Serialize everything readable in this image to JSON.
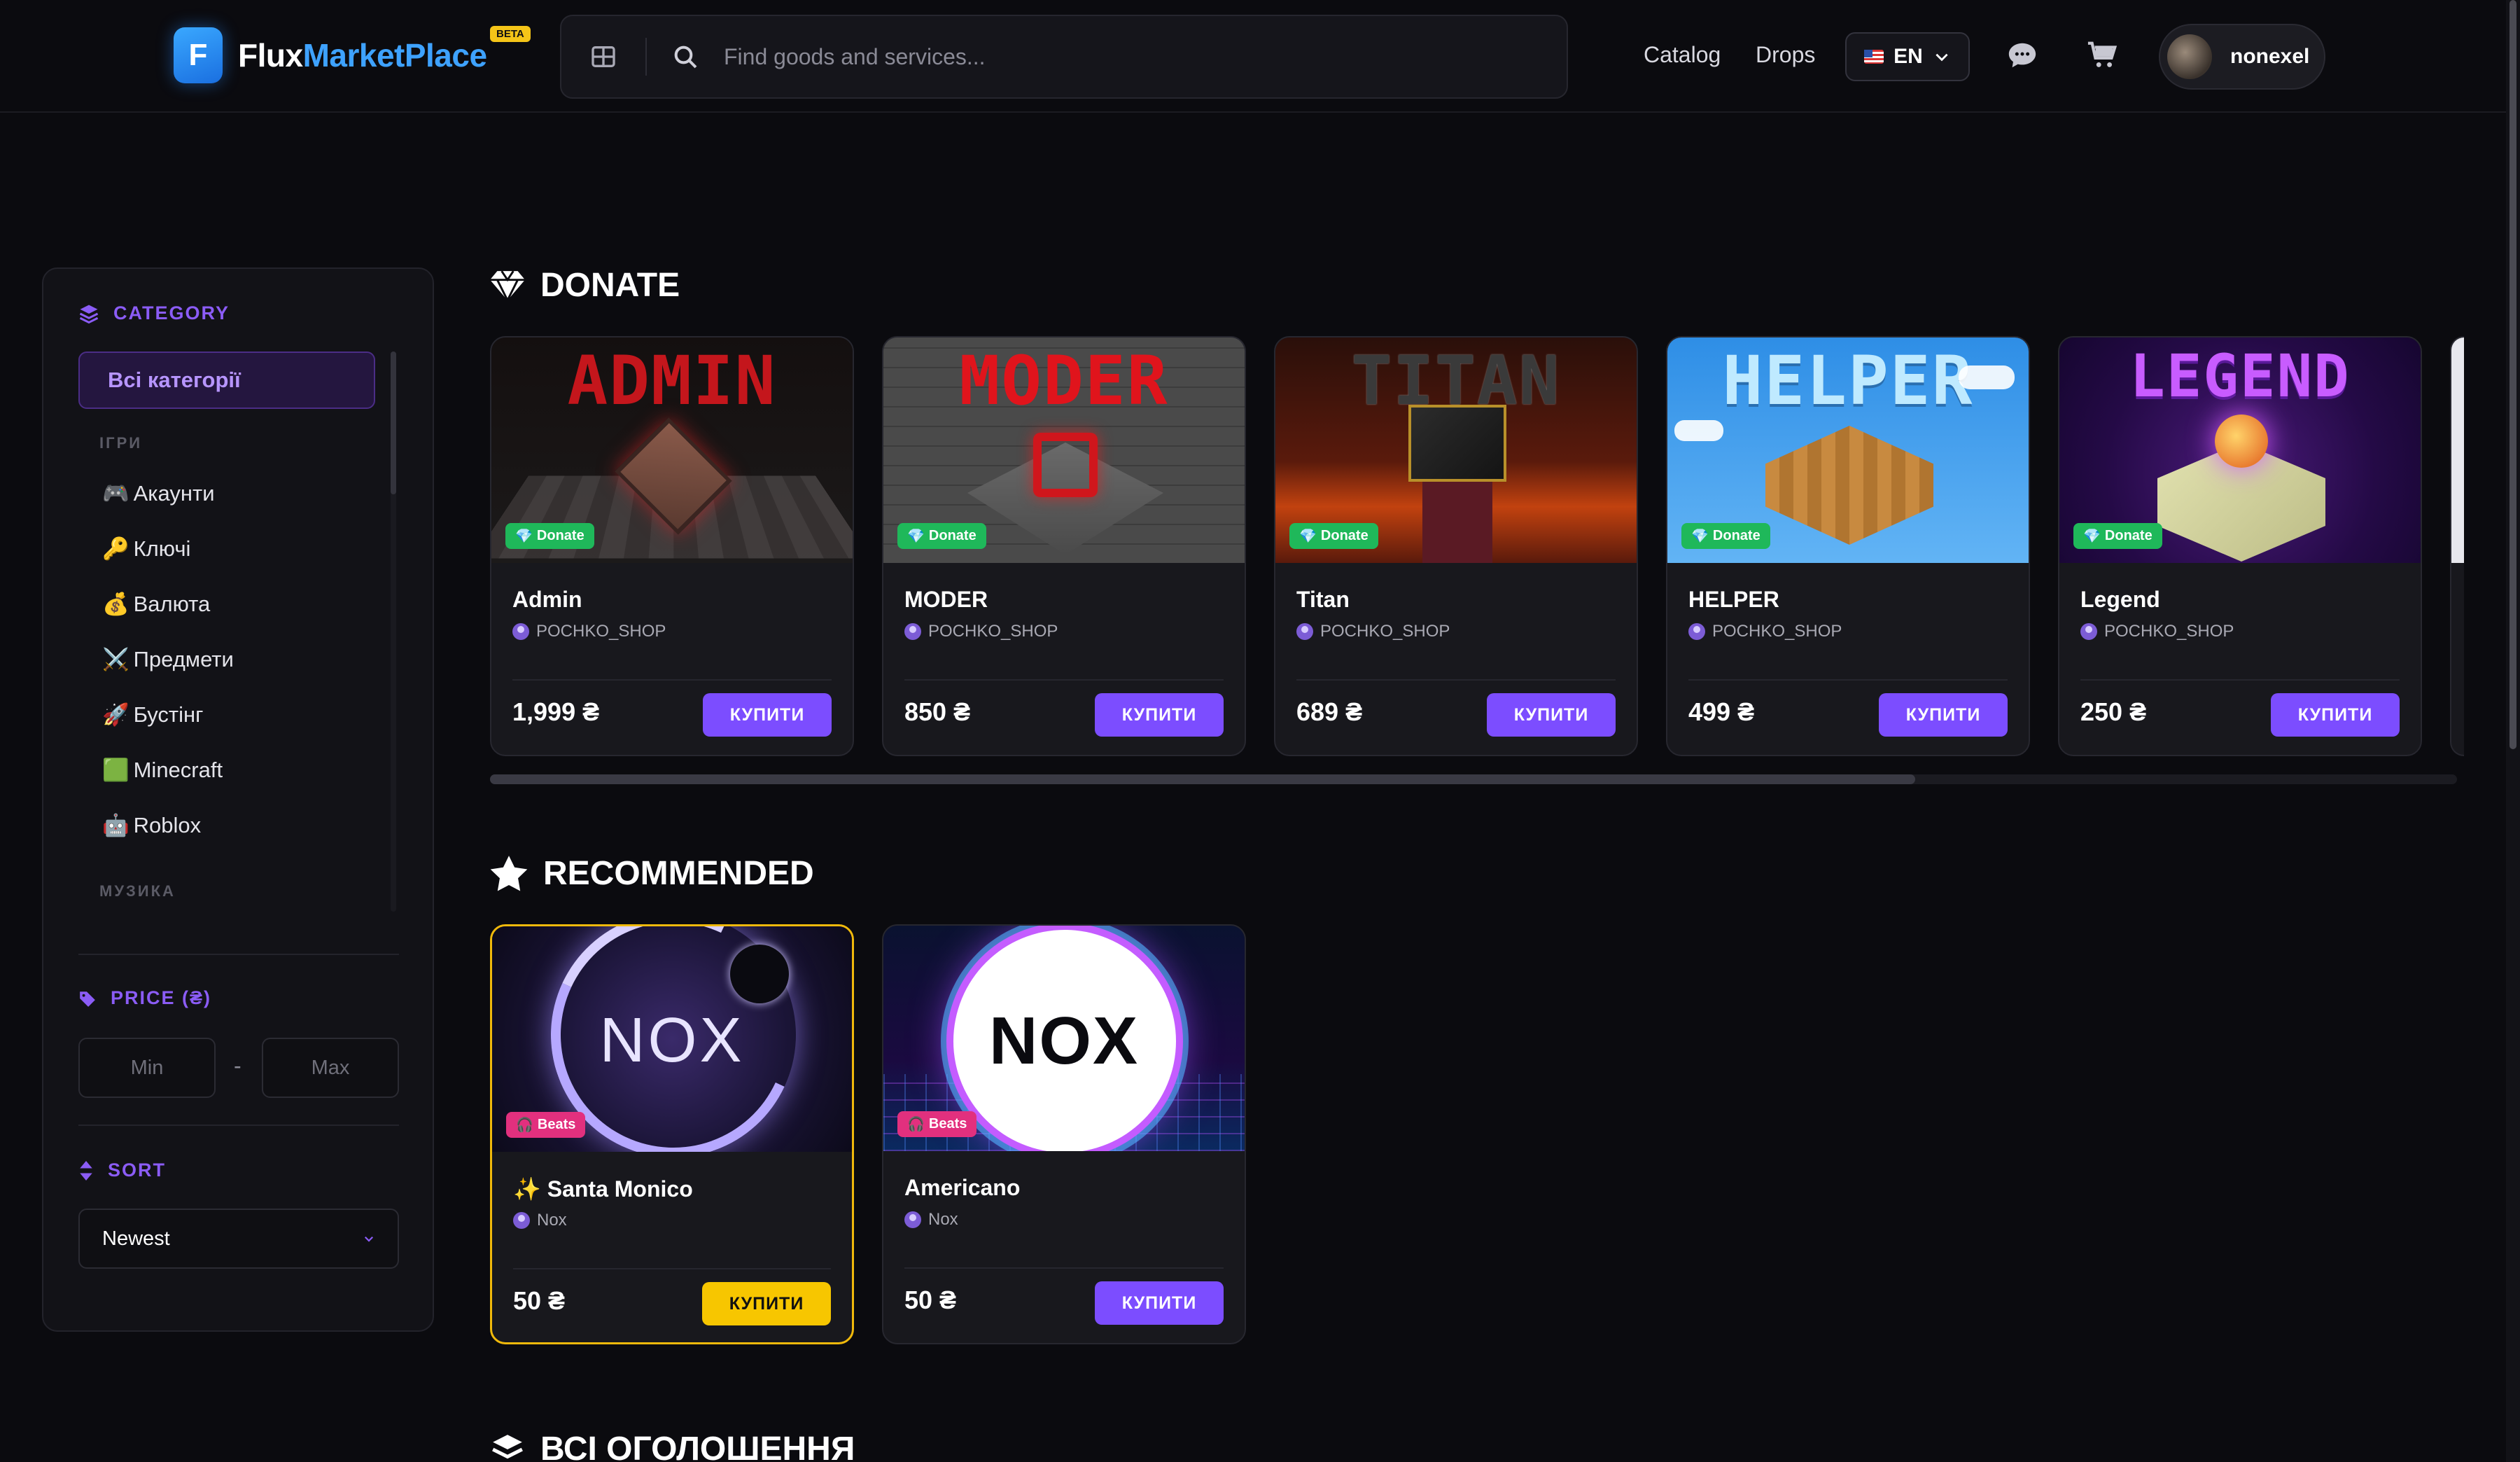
{
  "header": {
    "logo_letter": "F",
    "logo_flux": "Flux",
    "logo_marketplace": "MarketPlace",
    "beta": "BETA",
    "search_placeholder": "Find goods and services...",
    "nav": {
      "catalog": "Catalog",
      "drops": "Drops"
    },
    "language": "EN",
    "username": "nonexel"
  },
  "sidebar": {
    "category_title": "CATEGORY",
    "all_categories": "Всі категорії",
    "groups": [
      {
        "label": "ІГРИ",
        "items": [
          {
            "emoji": "🎮",
            "label": "Акаунти"
          },
          {
            "emoji": "🔑",
            "label": "Ключі"
          },
          {
            "emoji": "💰",
            "label": "Валюта"
          },
          {
            "emoji": "⚔️",
            "label": "Предмети"
          },
          {
            "emoji": "🚀",
            "label": "Бустінг"
          },
          {
            "emoji": "🟩",
            "label": "Minecraft"
          },
          {
            "emoji": "🤖",
            "label": "Roblox"
          }
        ]
      },
      {
        "label": "МУЗИКА",
        "items": []
      }
    ],
    "price_title": "PRICE (₴)",
    "price_min_placeholder": "Min",
    "price_max_placeholder": "Max",
    "price_dash": "-",
    "sort_title": "SORT",
    "sort_value": "Newest"
  },
  "sections": {
    "donate": {
      "title": "DONATE",
      "cards": [
        {
          "image_title": "ADMIN",
          "tag": "Donate",
          "name": "Admin",
          "seller": "POCHKO_SHOP",
          "price": "1,999 ₴",
          "buy": "КУПИТИ"
        },
        {
          "image_title": "MODER",
          "tag": "Donate",
          "name": "MODER",
          "seller": "POCHKO_SHOP",
          "price": "850 ₴",
          "buy": "КУПИТИ"
        },
        {
          "image_title": "TITAN",
          "tag": "Donate",
          "name": "Titan",
          "seller": "POCHKO_SHOP",
          "price": "689 ₴",
          "buy": "КУПИТИ"
        },
        {
          "image_title": "HELPER",
          "tag": "Donate",
          "name": "HELPER",
          "seller": "POCHKO_SHOP",
          "price": "499 ₴",
          "buy": "КУПИТИ"
        },
        {
          "image_title": "LEGEND",
          "tag": "Donate",
          "name": "Legend",
          "seller": "POCHKO_SHOP",
          "price": "250 ₴",
          "buy": "КУПИТИ"
        }
      ]
    },
    "recommended": {
      "title": "RECOMMENDED",
      "cards": [
        {
          "image_title": "NOX",
          "tag": "Beats",
          "name": "✨ Santa Monico",
          "seller": "Nox",
          "price": "50 ₴",
          "buy": "КУПИТИ",
          "featured": true
        },
        {
          "image_title": "NOX",
          "tag": "Beats",
          "name": "Americano",
          "seller": "Nox",
          "price": "50 ₴",
          "buy": "КУПИТИ",
          "featured": false
        }
      ]
    },
    "announcements": {
      "title": "ВСІ ОГОЛОШЕННЯ"
    }
  },
  "colors": {
    "accent": "#7c4dff",
    "sidebar_accent": "#8b5cf6",
    "gold": "#f7c600",
    "donate_tag": "#1fb85a",
    "beats_tag": "#e2307e",
    "brand_blue": "#3ea2ff"
  }
}
